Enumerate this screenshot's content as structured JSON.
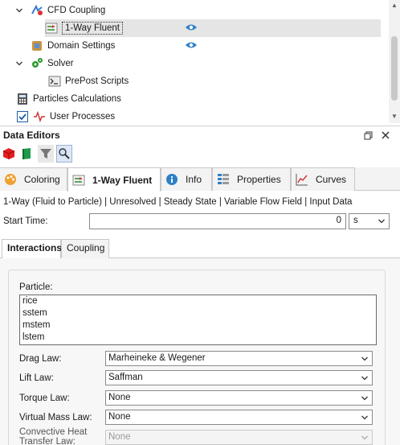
{
  "tree": {
    "items": [
      {
        "label": "CFD Coupling"
      },
      {
        "label": "1-Way Fluent"
      },
      {
        "label": "Domain Settings"
      },
      {
        "label": "Solver"
      },
      {
        "label": "PrePost Scripts"
      },
      {
        "label": "Particles Calculations"
      },
      {
        "label": "User Processes"
      }
    ]
  },
  "panel": {
    "title": "Data Editors"
  },
  "tabs": [
    {
      "label": "Coloring"
    },
    {
      "label": "1-Way Fluent"
    },
    {
      "label": "Info"
    },
    {
      "label": "Properties"
    },
    {
      "label": "Curves"
    }
  ],
  "summary": "1-Way (Fluid to Particle) | Unresolved | Steady State | Variable Flow Field | Input Data",
  "start_time": {
    "label": "Start Time:",
    "value": "0",
    "unit": "s"
  },
  "subtabs": [
    {
      "label": "Interactions"
    },
    {
      "label": "Coupling"
    }
  ],
  "particle": {
    "label": "Particle:",
    "items": [
      "rice",
      "sstem",
      "mstem",
      "lstem"
    ]
  },
  "fields": [
    {
      "label": "Drag Law:",
      "value": "Marheineke & Wegener"
    },
    {
      "label": "Lift Law:",
      "value": "Saffman"
    },
    {
      "label": "Torque Law:",
      "value": "None"
    },
    {
      "label": "Virtual Mass Law:",
      "value": "None"
    },
    {
      "label": "Convective Heat Transfer Law:",
      "value": "None"
    }
  ],
  "colors": {
    "accent": "#2f7fc8",
    "selection": "#e5e5e5"
  }
}
